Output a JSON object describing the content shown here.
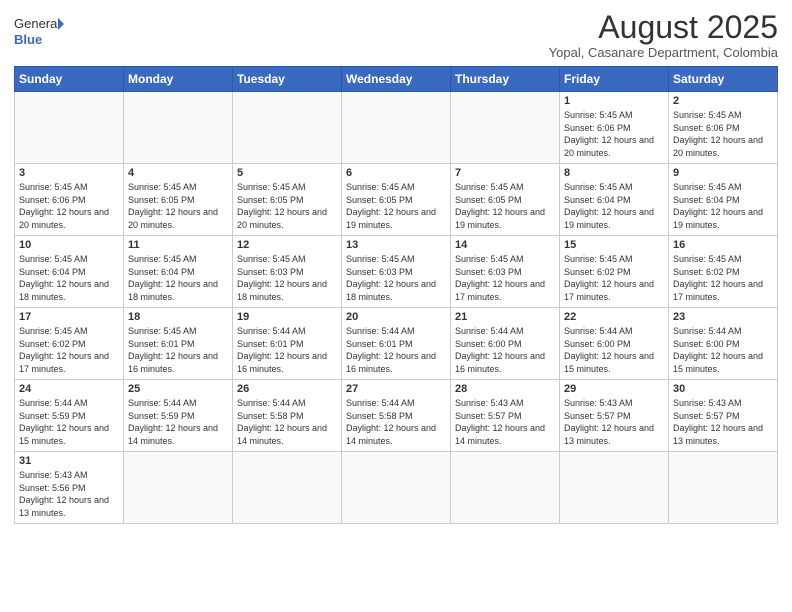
{
  "header": {
    "logo_general": "General",
    "logo_blue": "Blue",
    "month_year": "August 2025",
    "location": "Yopal, Casanare Department, Colombia"
  },
  "weekdays": [
    "Sunday",
    "Monday",
    "Tuesday",
    "Wednesday",
    "Thursday",
    "Friday",
    "Saturday"
  ],
  "weeks": [
    [
      {
        "day": "",
        "info": ""
      },
      {
        "day": "",
        "info": ""
      },
      {
        "day": "",
        "info": ""
      },
      {
        "day": "",
        "info": ""
      },
      {
        "day": "",
        "info": ""
      },
      {
        "day": "1",
        "info": "Sunrise: 5:45 AM\nSunset: 6:06 PM\nDaylight: 12 hours and 20 minutes."
      },
      {
        "day": "2",
        "info": "Sunrise: 5:45 AM\nSunset: 6:06 PM\nDaylight: 12 hours and 20 minutes."
      }
    ],
    [
      {
        "day": "3",
        "info": "Sunrise: 5:45 AM\nSunset: 6:06 PM\nDaylight: 12 hours and 20 minutes."
      },
      {
        "day": "4",
        "info": "Sunrise: 5:45 AM\nSunset: 6:05 PM\nDaylight: 12 hours and 20 minutes."
      },
      {
        "day": "5",
        "info": "Sunrise: 5:45 AM\nSunset: 6:05 PM\nDaylight: 12 hours and 20 minutes."
      },
      {
        "day": "6",
        "info": "Sunrise: 5:45 AM\nSunset: 6:05 PM\nDaylight: 12 hours and 19 minutes."
      },
      {
        "day": "7",
        "info": "Sunrise: 5:45 AM\nSunset: 6:05 PM\nDaylight: 12 hours and 19 minutes."
      },
      {
        "day": "8",
        "info": "Sunrise: 5:45 AM\nSunset: 6:04 PM\nDaylight: 12 hours and 19 minutes."
      },
      {
        "day": "9",
        "info": "Sunrise: 5:45 AM\nSunset: 6:04 PM\nDaylight: 12 hours and 19 minutes."
      }
    ],
    [
      {
        "day": "10",
        "info": "Sunrise: 5:45 AM\nSunset: 6:04 PM\nDaylight: 12 hours and 18 minutes."
      },
      {
        "day": "11",
        "info": "Sunrise: 5:45 AM\nSunset: 6:04 PM\nDaylight: 12 hours and 18 minutes."
      },
      {
        "day": "12",
        "info": "Sunrise: 5:45 AM\nSunset: 6:03 PM\nDaylight: 12 hours and 18 minutes."
      },
      {
        "day": "13",
        "info": "Sunrise: 5:45 AM\nSunset: 6:03 PM\nDaylight: 12 hours and 18 minutes."
      },
      {
        "day": "14",
        "info": "Sunrise: 5:45 AM\nSunset: 6:03 PM\nDaylight: 12 hours and 17 minutes."
      },
      {
        "day": "15",
        "info": "Sunrise: 5:45 AM\nSunset: 6:02 PM\nDaylight: 12 hours and 17 minutes."
      },
      {
        "day": "16",
        "info": "Sunrise: 5:45 AM\nSunset: 6:02 PM\nDaylight: 12 hours and 17 minutes."
      }
    ],
    [
      {
        "day": "17",
        "info": "Sunrise: 5:45 AM\nSunset: 6:02 PM\nDaylight: 12 hours and 17 minutes."
      },
      {
        "day": "18",
        "info": "Sunrise: 5:45 AM\nSunset: 6:01 PM\nDaylight: 12 hours and 16 minutes."
      },
      {
        "day": "19",
        "info": "Sunrise: 5:44 AM\nSunset: 6:01 PM\nDaylight: 12 hours and 16 minutes."
      },
      {
        "day": "20",
        "info": "Sunrise: 5:44 AM\nSunset: 6:01 PM\nDaylight: 12 hours and 16 minutes."
      },
      {
        "day": "21",
        "info": "Sunrise: 5:44 AM\nSunset: 6:00 PM\nDaylight: 12 hours and 16 minutes."
      },
      {
        "day": "22",
        "info": "Sunrise: 5:44 AM\nSunset: 6:00 PM\nDaylight: 12 hours and 15 minutes."
      },
      {
        "day": "23",
        "info": "Sunrise: 5:44 AM\nSunset: 6:00 PM\nDaylight: 12 hours and 15 minutes."
      }
    ],
    [
      {
        "day": "24",
        "info": "Sunrise: 5:44 AM\nSunset: 5:59 PM\nDaylight: 12 hours and 15 minutes."
      },
      {
        "day": "25",
        "info": "Sunrise: 5:44 AM\nSunset: 5:59 PM\nDaylight: 12 hours and 14 minutes."
      },
      {
        "day": "26",
        "info": "Sunrise: 5:44 AM\nSunset: 5:58 PM\nDaylight: 12 hours and 14 minutes."
      },
      {
        "day": "27",
        "info": "Sunrise: 5:44 AM\nSunset: 5:58 PM\nDaylight: 12 hours and 14 minutes."
      },
      {
        "day": "28",
        "info": "Sunrise: 5:43 AM\nSunset: 5:57 PM\nDaylight: 12 hours and 14 minutes."
      },
      {
        "day": "29",
        "info": "Sunrise: 5:43 AM\nSunset: 5:57 PM\nDaylight: 12 hours and 13 minutes."
      },
      {
        "day": "30",
        "info": "Sunrise: 5:43 AM\nSunset: 5:57 PM\nDaylight: 12 hours and 13 minutes."
      }
    ],
    [
      {
        "day": "31",
        "info": "Sunrise: 5:43 AM\nSunset: 5:56 PM\nDaylight: 12 hours and 13 minutes."
      },
      {
        "day": "",
        "info": ""
      },
      {
        "day": "",
        "info": ""
      },
      {
        "day": "",
        "info": ""
      },
      {
        "day": "",
        "info": ""
      },
      {
        "day": "",
        "info": ""
      },
      {
        "day": "",
        "info": ""
      }
    ]
  ]
}
